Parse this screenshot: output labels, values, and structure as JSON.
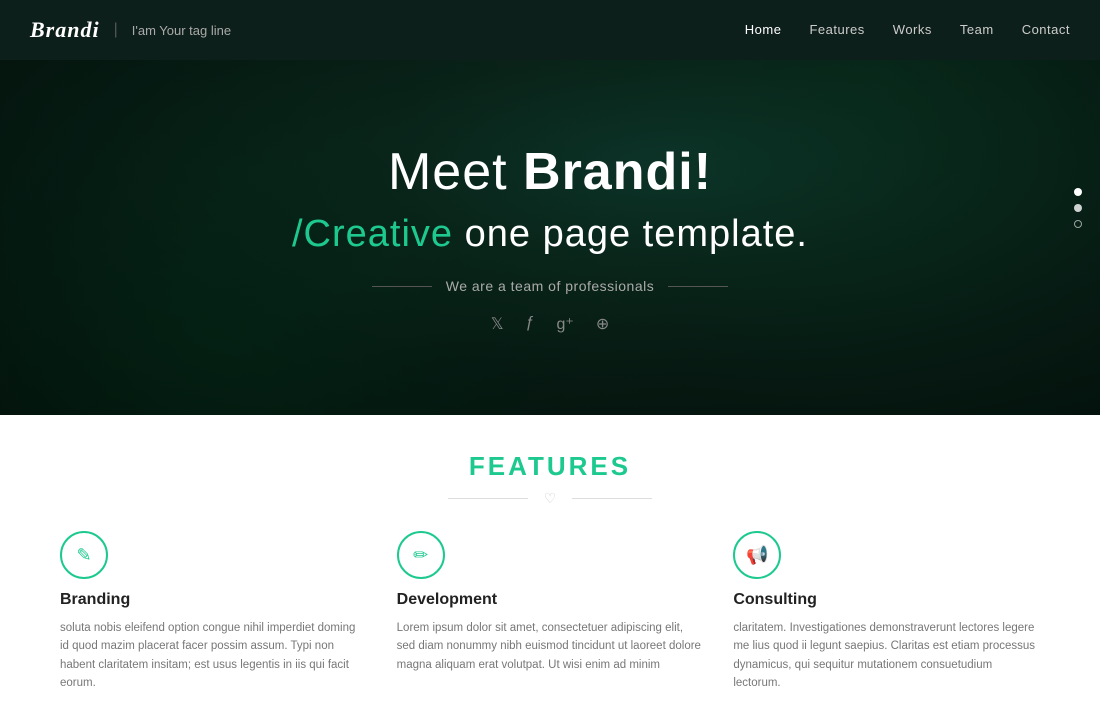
{
  "navbar": {
    "logo": "Brandi",
    "divider": "|",
    "tagline": "I'am Your tag line",
    "links": [
      {
        "label": "Home",
        "active": true
      },
      {
        "label": "Features",
        "active": false
      },
      {
        "label": "Works",
        "active": false
      },
      {
        "label": "Team",
        "active": false
      },
      {
        "label": "Contact",
        "active": false
      }
    ]
  },
  "hero": {
    "title_plain": "Meet ",
    "title_bold": "Brandi!",
    "subtitle_green": "/Creative",
    "subtitle_rest": " one page template.",
    "tagline": "We are a team of professionals",
    "social_icons": [
      "twitter",
      "facebook",
      "googleplus",
      "globe"
    ],
    "dots": [
      {
        "active": true
      },
      {
        "active": false,
        "hollow": false
      },
      {
        "active": false,
        "hollow": true
      }
    ]
  },
  "features": {
    "title": "FEATURES",
    "items": [
      {
        "icon": "✎",
        "name": "Branding",
        "desc": "soluta nobis eleifend option congue nihil imperdiet doming id quod mazim placerat facer possim assum. Typi non habent claritatem insitam; est usus legentis in iis qui facit eorum."
      },
      {
        "icon": "✏",
        "name": "Development",
        "desc": "Lorem ipsum dolor sit amet, consectetuer adipiscing elit, sed diam nonummy nibh euismod tincidunt ut laoreet dolore magna aliquam erat volutpat. Ut wisi enim ad minim"
      },
      {
        "icon": "📢",
        "name": "Consulting",
        "desc": "claritatem. Investigationes demonstraverunt lectores legere me lius quod ii legunt saepius. Claritas est etiam processus dynamicus, qui sequitur mutationem consuetudium lectorum."
      }
    ]
  }
}
